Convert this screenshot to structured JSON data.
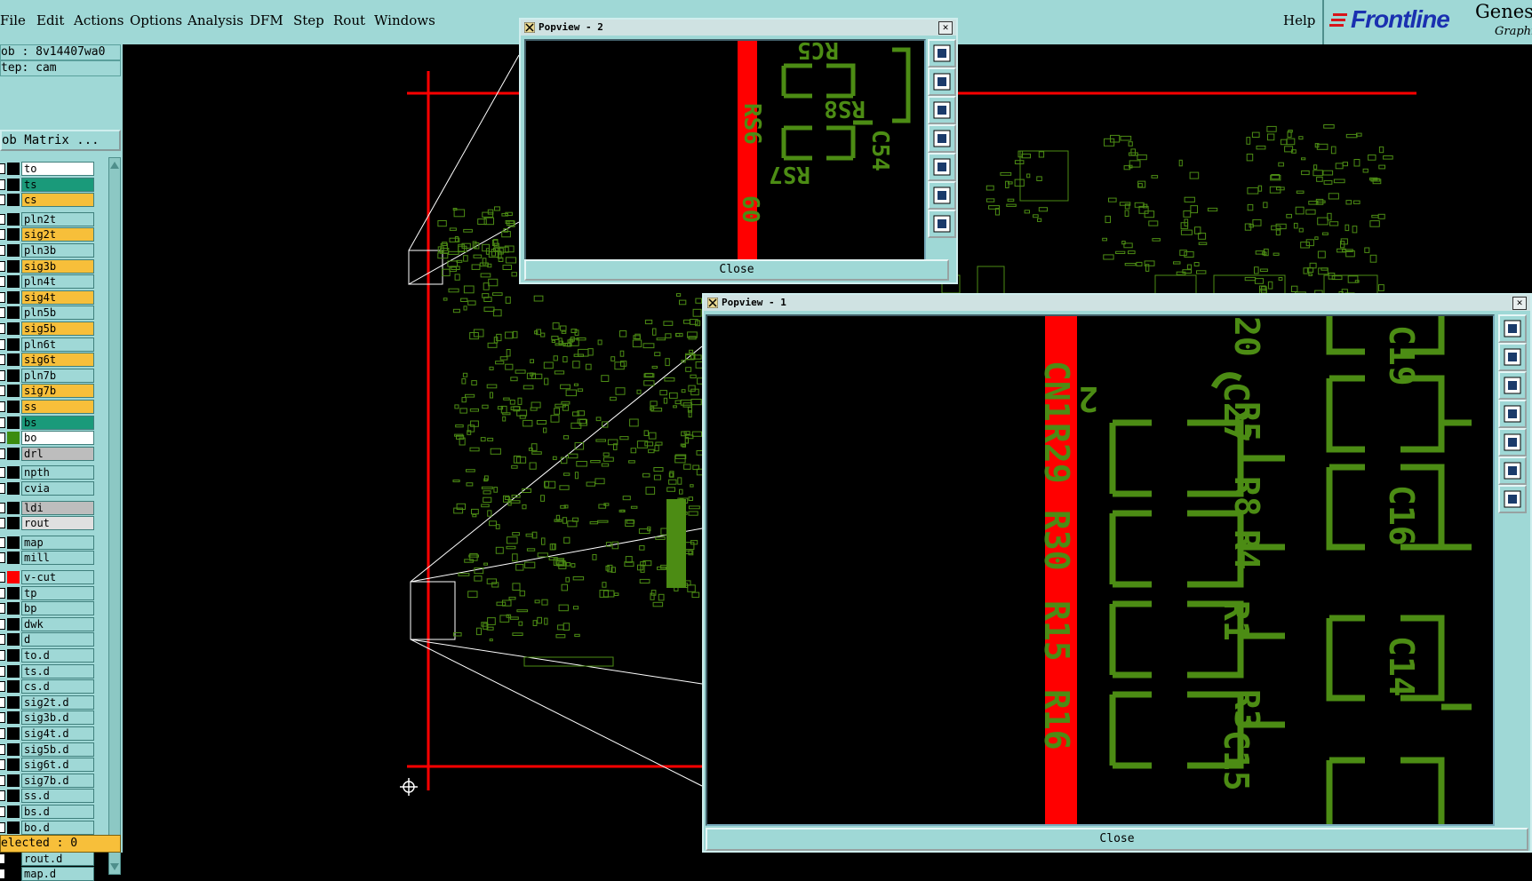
{
  "menubar": {
    "items": [
      "File",
      "Edit",
      "Actions",
      "Options",
      "Analysis",
      "DFM",
      "Step",
      "Rout",
      "Windows"
    ],
    "help": "Help",
    "logo": {
      "brand": "Frontline",
      "product": "Genes",
      "sub": "Graphi"
    }
  },
  "left_panel": {
    "job_line": "ob : 8v14407wa0",
    "step_line": "tep: cam",
    "job_matrix_button": "ob Matrix ...",
    "layers": [
      {
        "name": "to",
        "color": "#ffffff",
        "swatch": "#000000"
      },
      {
        "name": "ts",
        "color": "#1a9a7a",
        "swatch": "#000000"
      },
      {
        "name": "cs",
        "color": "#f7bf3a",
        "swatch": "#000000"
      },
      {
        "name": "pln2t",
        "color": "#9fd8d6",
        "swatch": "#000000"
      },
      {
        "name": "sig2t",
        "color": "#f7bf3a",
        "swatch": "#000000"
      },
      {
        "name": "pln3b",
        "color": "#9fd8d6",
        "swatch": "#000000"
      },
      {
        "name": "sig3b",
        "color": "#f7bf3a",
        "swatch": "#000000"
      },
      {
        "name": "pln4t",
        "color": "#9fd8d6",
        "swatch": "#000000"
      },
      {
        "name": "sig4t",
        "color": "#f7bf3a",
        "swatch": "#000000"
      },
      {
        "name": "pln5b",
        "color": "#9fd8d6",
        "swatch": "#000000"
      },
      {
        "name": "sig5b",
        "color": "#f7bf3a",
        "swatch": "#000000"
      },
      {
        "name": "pln6t",
        "color": "#9fd8d6",
        "swatch": "#000000"
      },
      {
        "name": "sig6t",
        "color": "#f7bf3a",
        "swatch": "#000000"
      },
      {
        "name": "pln7b",
        "color": "#9fd8d6",
        "swatch": "#000000"
      },
      {
        "name": "sig7b",
        "color": "#f7bf3a",
        "swatch": "#000000"
      },
      {
        "name": "ss",
        "color": "#f7bf3a",
        "swatch": "#000000"
      },
      {
        "name": "bs",
        "color": "#1a9a7a",
        "swatch": "#000000"
      },
      {
        "name": "bo",
        "color": "#ffffff",
        "swatch": "#3c8c10"
      },
      {
        "name": "drl",
        "color": "#bdbdbd",
        "swatch": "#000000"
      },
      {
        "name": "npth",
        "color": "#9fd8d6",
        "swatch": "#000000"
      },
      {
        "name": "cvia",
        "color": "#9fd8d6",
        "swatch": "#000000"
      },
      {
        "name": "ldi",
        "color": "#bdbdbd",
        "swatch": "#000000"
      },
      {
        "name": "rout",
        "color": "#e0e0e0",
        "swatch": "#000000"
      },
      {
        "name": "map",
        "color": "#9fd8d6",
        "swatch": "#000000"
      },
      {
        "name": "mill",
        "color": "#9fd8d6",
        "swatch": "#000000"
      },
      {
        "name": "v-cut",
        "color": "#9fd8d6",
        "swatch": "#ff0000"
      },
      {
        "name": "tp",
        "color": "#9fd8d6",
        "swatch": "#000000"
      },
      {
        "name": "bp",
        "color": "#9fd8d6",
        "swatch": "#000000"
      },
      {
        "name": "dwk",
        "color": "#9fd8d6",
        "swatch": "#000000"
      },
      {
        "name": "d",
        "color": "#9fd8d6",
        "swatch": "#000000"
      },
      {
        "name": "to.d",
        "color": "#9fd8d6",
        "swatch": "#000000"
      },
      {
        "name": "ts.d",
        "color": "#9fd8d6",
        "swatch": "#000000"
      },
      {
        "name": "cs.d",
        "color": "#9fd8d6",
        "swatch": "#000000"
      },
      {
        "name": "sig2t.d",
        "color": "#9fd8d6",
        "swatch": "#000000"
      },
      {
        "name": "sig3b.d",
        "color": "#9fd8d6",
        "swatch": "#000000"
      },
      {
        "name": "sig4t.d",
        "color": "#9fd8d6",
        "swatch": "#000000"
      },
      {
        "name": "sig5b.d",
        "color": "#9fd8d6",
        "swatch": "#000000"
      },
      {
        "name": "sig6t.d",
        "color": "#9fd8d6",
        "swatch": "#000000"
      },
      {
        "name": "sig7b.d",
        "color": "#9fd8d6",
        "swatch": "#000000"
      },
      {
        "name": "ss.d",
        "color": "#9fd8d6",
        "swatch": "#000000"
      },
      {
        "name": "bs.d",
        "color": "#9fd8d6",
        "swatch": "#000000"
      },
      {
        "name": "bo.d",
        "color": "#9fd8d6",
        "swatch": "#000000"
      },
      {
        "name": "drl.d",
        "color": "#9fd8d6",
        "swatch": "#000000"
      },
      {
        "name": "rout.d",
        "color": "#9fd8d6",
        "swatch": "#000000"
      },
      {
        "name": "map.d",
        "color": "#9fd8d6",
        "swatch": "#000000"
      }
    ],
    "selected_line": "elected : 0"
  },
  "popview2": {
    "title": "Popview - 2",
    "close_label": "Close",
    "silk": [
      "RC5",
      "RS8",
      "RS6",
      "C54",
      "RS7",
      "60"
    ]
  },
  "popview1": {
    "title": "Popview - 1",
    "close_label": "Close",
    "silk": [
      "CN1",
      "R29",
      "R30",
      "R15",
      "R16",
      "2",
      "C27",
      "R5",
      "R8",
      "R4",
      "R1",
      "R3",
      "C15",
      "C16",
      "C14",
      "C19",
      "20"
    ]
  },
  "colors": {
    "panel": "#9fd8d6",
    "copper": "#4c8c14",
    "highlight": "#ff0000",
    "outline": "#ffffff"
  }
}
